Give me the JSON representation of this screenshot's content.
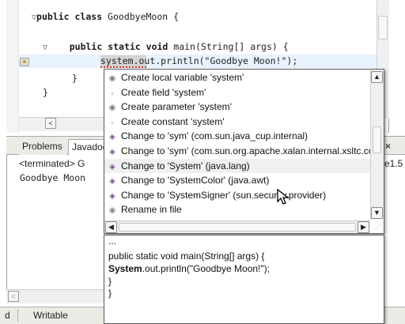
{
  "editor": {
    "code_lines": [
      {
        "fold": "▽",
        "keyword": "public class",
        "rest": " GoodbyeMoon {"
      },
      {
        "fold": "▽",
        "keyword": "public static void",
        "rest": " main(String[] args) {"
      },
      {
        "token": "system",
        "rest": ".out.println(\"Goodbye Moon!\");"
      },
      {
        "text": "}"
      },
      {
        "text": "}"
      }
    ],
    "scroll_left": "<"
  },
  "quickfix": {
    "items": [
      {
        "icon": "local-variable-icon",
        "glyph": "◉",
        "label": "Create local variable 'system'"
      },
      {
        "icon": "field-icon",
        "glyph": "▫",
        "label": "Create field 'system'"
      },
      {
        "icon": "parameter-icon",
        "glyph": "◉",
        "label": "Create parameter 'system'"
      },
      {
        "icon": "constant-icon",
        "glyph": "▫",
        "label": "Create constant 'system'"
      },
      {
        "icon": "change-icon",
        "glyph": "◈",
        "label": "Change to 'sym' (com.sun.java_cup.internal)"
      },
      {
        "icon": "change-icon",
        "glyph": "◈",
        "label": "Change to 'sym' (com.sun.org.apache.xalan.internal.xsltc.compiler)"
      },
      {
        "icon": "change-icon",
        "glyph": "◈",
        "label": "Change to 'System' (java.lang)"
      },
      {
        "icon": "change-icon",
        "glyph": "◈",
        "label": "Change to 'SystemColor' (java.awt)"
      },
      {
        "icon": "change-icon",
        "glyph": "◈",
        "label": "Change to 'SystemSigner' (sun.security.provider)"
      },
      {
        "icon": "rename-icon",
        "glyph": "◉",
        "label": "Rename in file"
      }
    ],
    "selected_index": 6,
    "scroll_up": "▲",
    "scroll_down": "▼",
    "scroll_left": "◀",
    "scroll_right": "▶"
  },
  "preview": {
    "lines": [
      {
        "text": "..."
      },
      {
        "text": "public static void main(String[] args) {"
      },
      {
        "bold": "System",
        "rest": ".out.println(\"Goodbye Moon!\");"
      },
      {
        "text": "}"
      },
      {
        "text": "}"
      }
    ]
  },
  "views": {
    "tabs": [
      "Problems",
      "Javadoc"
    ],
    "console_status": "<terminated> G",
    "console_status_right": "e1.5",
    "console_output": "Goodbye Moon",
    "close_glyph": "×"
  },
  "statusbar": {
    "left": "d",
    "mode": "Writable"
  }
}
